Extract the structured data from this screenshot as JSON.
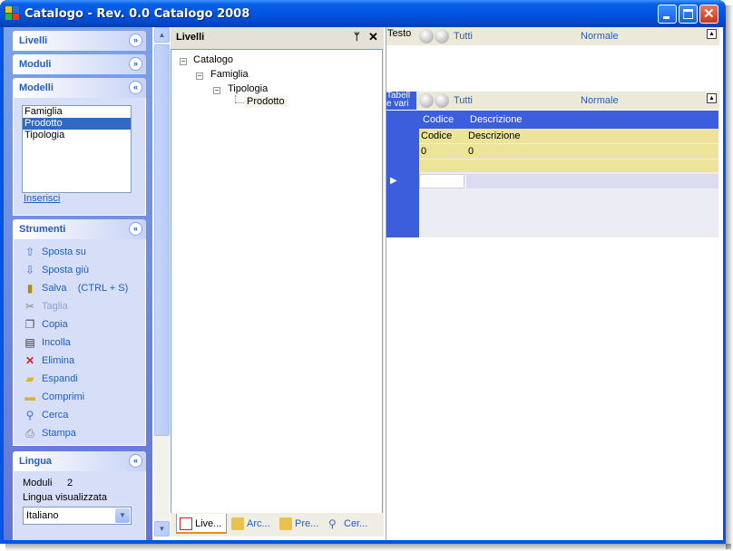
{
  "window": {
    "title": "Catalogo - Rev. 0.0 Catalogo 2008",
    "buttons": [
      "minimize",
      "maximize",
      "close"
    ]
  },
  "taskpane": {
    "livelli": {
      "title": "Livelli"
    },
    "moduli": {
      "title": "Moduli"
    },
    "modelli": {
      "title": "Modelli",
      "items": [
        "Famiglia",
        "Prodotto",
        "Tipologia"
      ],
      "selected": "Prodotto",
      "link": "Inserisci"
    },
    "strumenti": {
      "title": "Strumenti",
      "items": [
        {
          "label": "Sposta su",
          "icon": "arrow-up-icon",
          "enabled": true
        },
        {
          "label": "Sposta giù",
          "icon": "arrow-down-icon",
          "enabled": true
        },
        {
          "label": "Salva    (CTRL + S)",
          "icon": "save-icon",
          "enabled": true
        },
        {
          "label": "Taglia",
          "icon": "scissors-icon",
          "enabled": false
        },
        {
          "label": "Copia",
          "icon": "copy-icon",
          "enabled": true
        },
        {
          "label": "Incolla",
          "icon": "paste-icon",
          "enabled": true
        },
        {
          "label": "Elimina",
          "icon": "delete-icon",
          "enabled": true
        },
        {
          "label": "Espandi",
          "icon": "folder-open-icon",
          "enabled": true
        },
        {
          "label": "Comprimi",
          "icon": "folder-icon",
          "enabled": true
        },
        {
          "label": "Cerca",
          "icon": "search-icon",
          "enabled": true
        },
        {
          "label": "Stampa",
          "icon": "printer-icon",
          "enabled": true
        }
      ]
    },
    "lingua": {
      "title": "Lingua",
      "moduli_label": "Moduli",
      "moduli_value": "2",
      "display_label": "Lingua visualizzata",
      "selected": "Italiano"
    }
  },
  "tree_panel": {
    "title": "Livelli",
    "nodes": [
      {
        "label": "Catalogo",
        "level": 0
      },
      {
        "label": "Famiglia",
        "level": 1
      },
      {
        "label": "Tipologia",
        "level": 2
      },
      {
        "label": "Prodotto",
        "level": 3
      }
    ],
    "tabs": [
      "Live...",
      "Arc...",
      "Pre...",
      "Cer..."
    ]
  },
  "right": {
    "group1": {
      "label": "Testo",
      "filter": "Tutti",
      "mode": "Normale"
    },
    "group2": {
      "label": "Tabell e vari",
      "filter": "Tutti",
      "mode": "Normale"
    },
    "grid": {
      "columns": [
        "Codice",
        "Descrizione"
      ],
      "rows": [
        [
          "Codice",
          "Descrizione"
        ],
        [
          "0",
          "0"
        ],
        [
          "",
          ""
        ]
      ]
    }
  },
  "colors": {
    "accent": "#215dc6",
    "titlebar": "#0054e3",
    "grid_header": "#3a5edc",
    "grid_row": "#ede49a"
  }
}
